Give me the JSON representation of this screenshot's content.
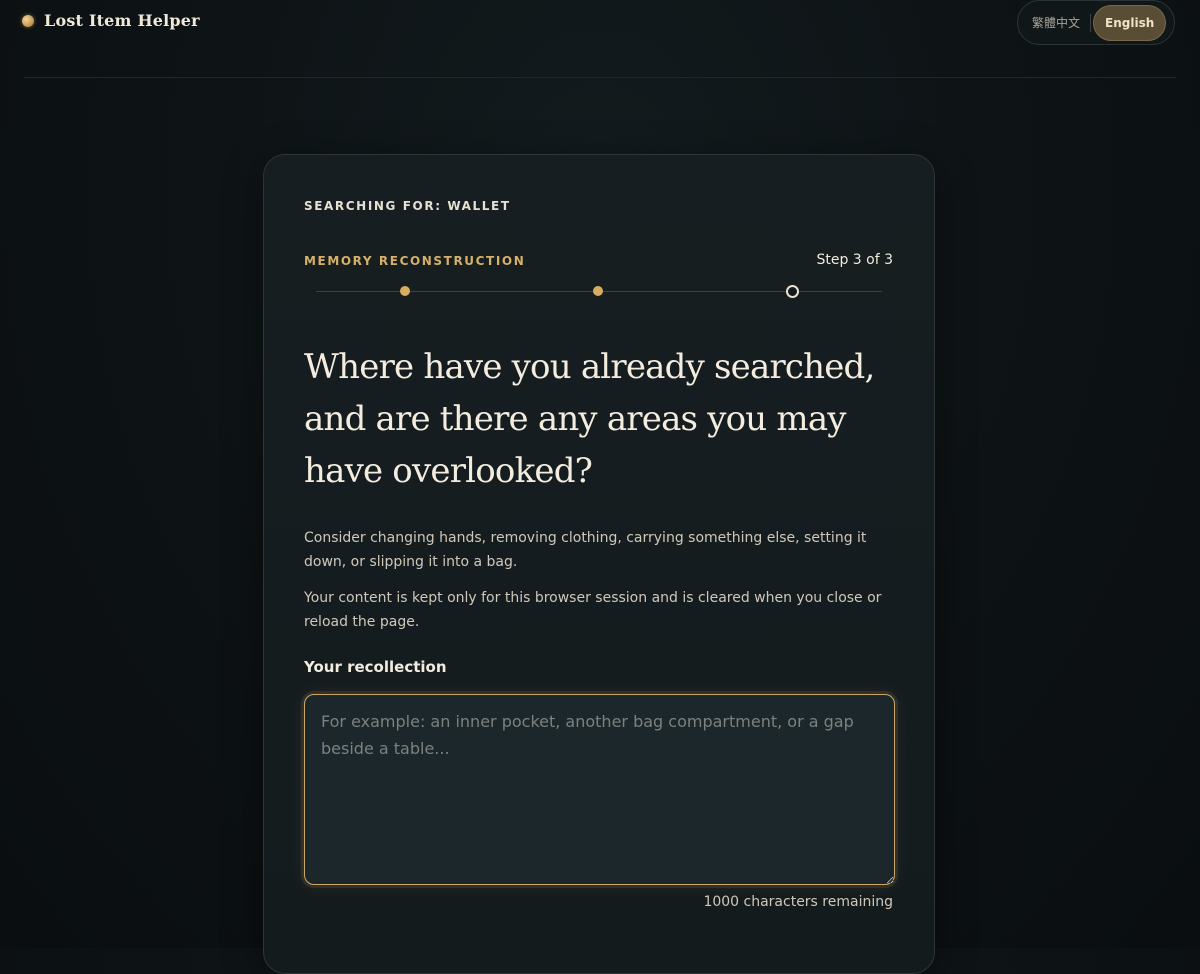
{
  "header": {
    "brand_name": "Lost Item Helper",
    "languages": [
      {
        "label": "繁體中文",
        "active": false
      },
      {
        "label": "English",
        "active": true
      }
    ]
  },
  "card": {
    "searching_for": "SEARCHING FOR: WALLET",
    "section_label": "MEMORY RECONSTRUCTION",
    "step_text": "Step 3 of 3",
    "progress": {
      "current_step": 3,
      "total_steps": 3
    },
    "question": "Where have you already searched, and are there any areas you may have overlooked?",
    "hint_1": "Consider changing hands, removing clothing, carrying something else, setting it down, or slipping it into a bag.",
    "hint_2": "Your content is kept only for this browser session and is cleared when you close or reload the page.",
    "field_label": "Your recollection",
    "recollection_placeholder": "For example: an inner pocket, another bag compartment, or a gap beside a table...",
    "recollection_value": "",
    "counter_text": "1000 characters remaining"
  },
  "colors": {
    "accent_gold": "#d6b06a",
    "background": "#0d1214",
    "card_background": "#161e21"
  }
}
